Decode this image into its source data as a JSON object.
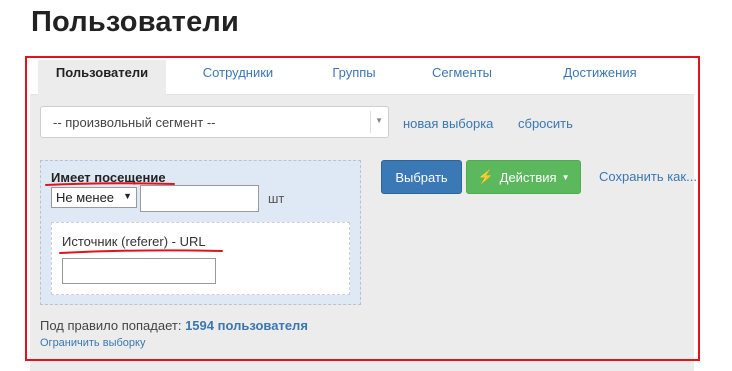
{
  "page": {
    "title": "Пользователи"
  },
  "tabs": [
    {
      "label": "Пользователи",
      "active": true
    },
    {
      "label": "Сотрудники",
      "active": false
    },
    {
      "label": "Группы",
      "active": false
    },
    {
      "label": "Сегменты",
      "active": false
    },
    {
      "label": "Достижения",
      "active": false
    }
  ],
  "segment": {
    "selected": "-- произвольный сегмент --",
    "new_selection_label": "новая выборка",
    "reset_label": "сбросить"
  },
  "rule": {
    "title": "Имеет посещение",
    "comparison": "Не менее",
    "count_value": "",
    "unit": "шт",
    "source_label": "Источник (referer) - URL",
    "source_value": ""
  },
  "actions": {
    "select_label": "Выбрать",
    "actions_label": "Действия",
    "actions_icon": "bolt-icon",
    "save_as_label": "Сохранить как..."
  },
  "summary": {
    "prefix": "Под правило попадает:",
    "count": "1594 пользователя",
    "limit_label": "Ограничить выборку"
  },
  "colors": {
    "accent_link": "#3a77b3",
    "primary_button": "#3a78b6",
    "success_button": "#5cb85c",
    "annotation_red": "#e1141c",
    "rule_background": "#dfe9f5"
  }
}
